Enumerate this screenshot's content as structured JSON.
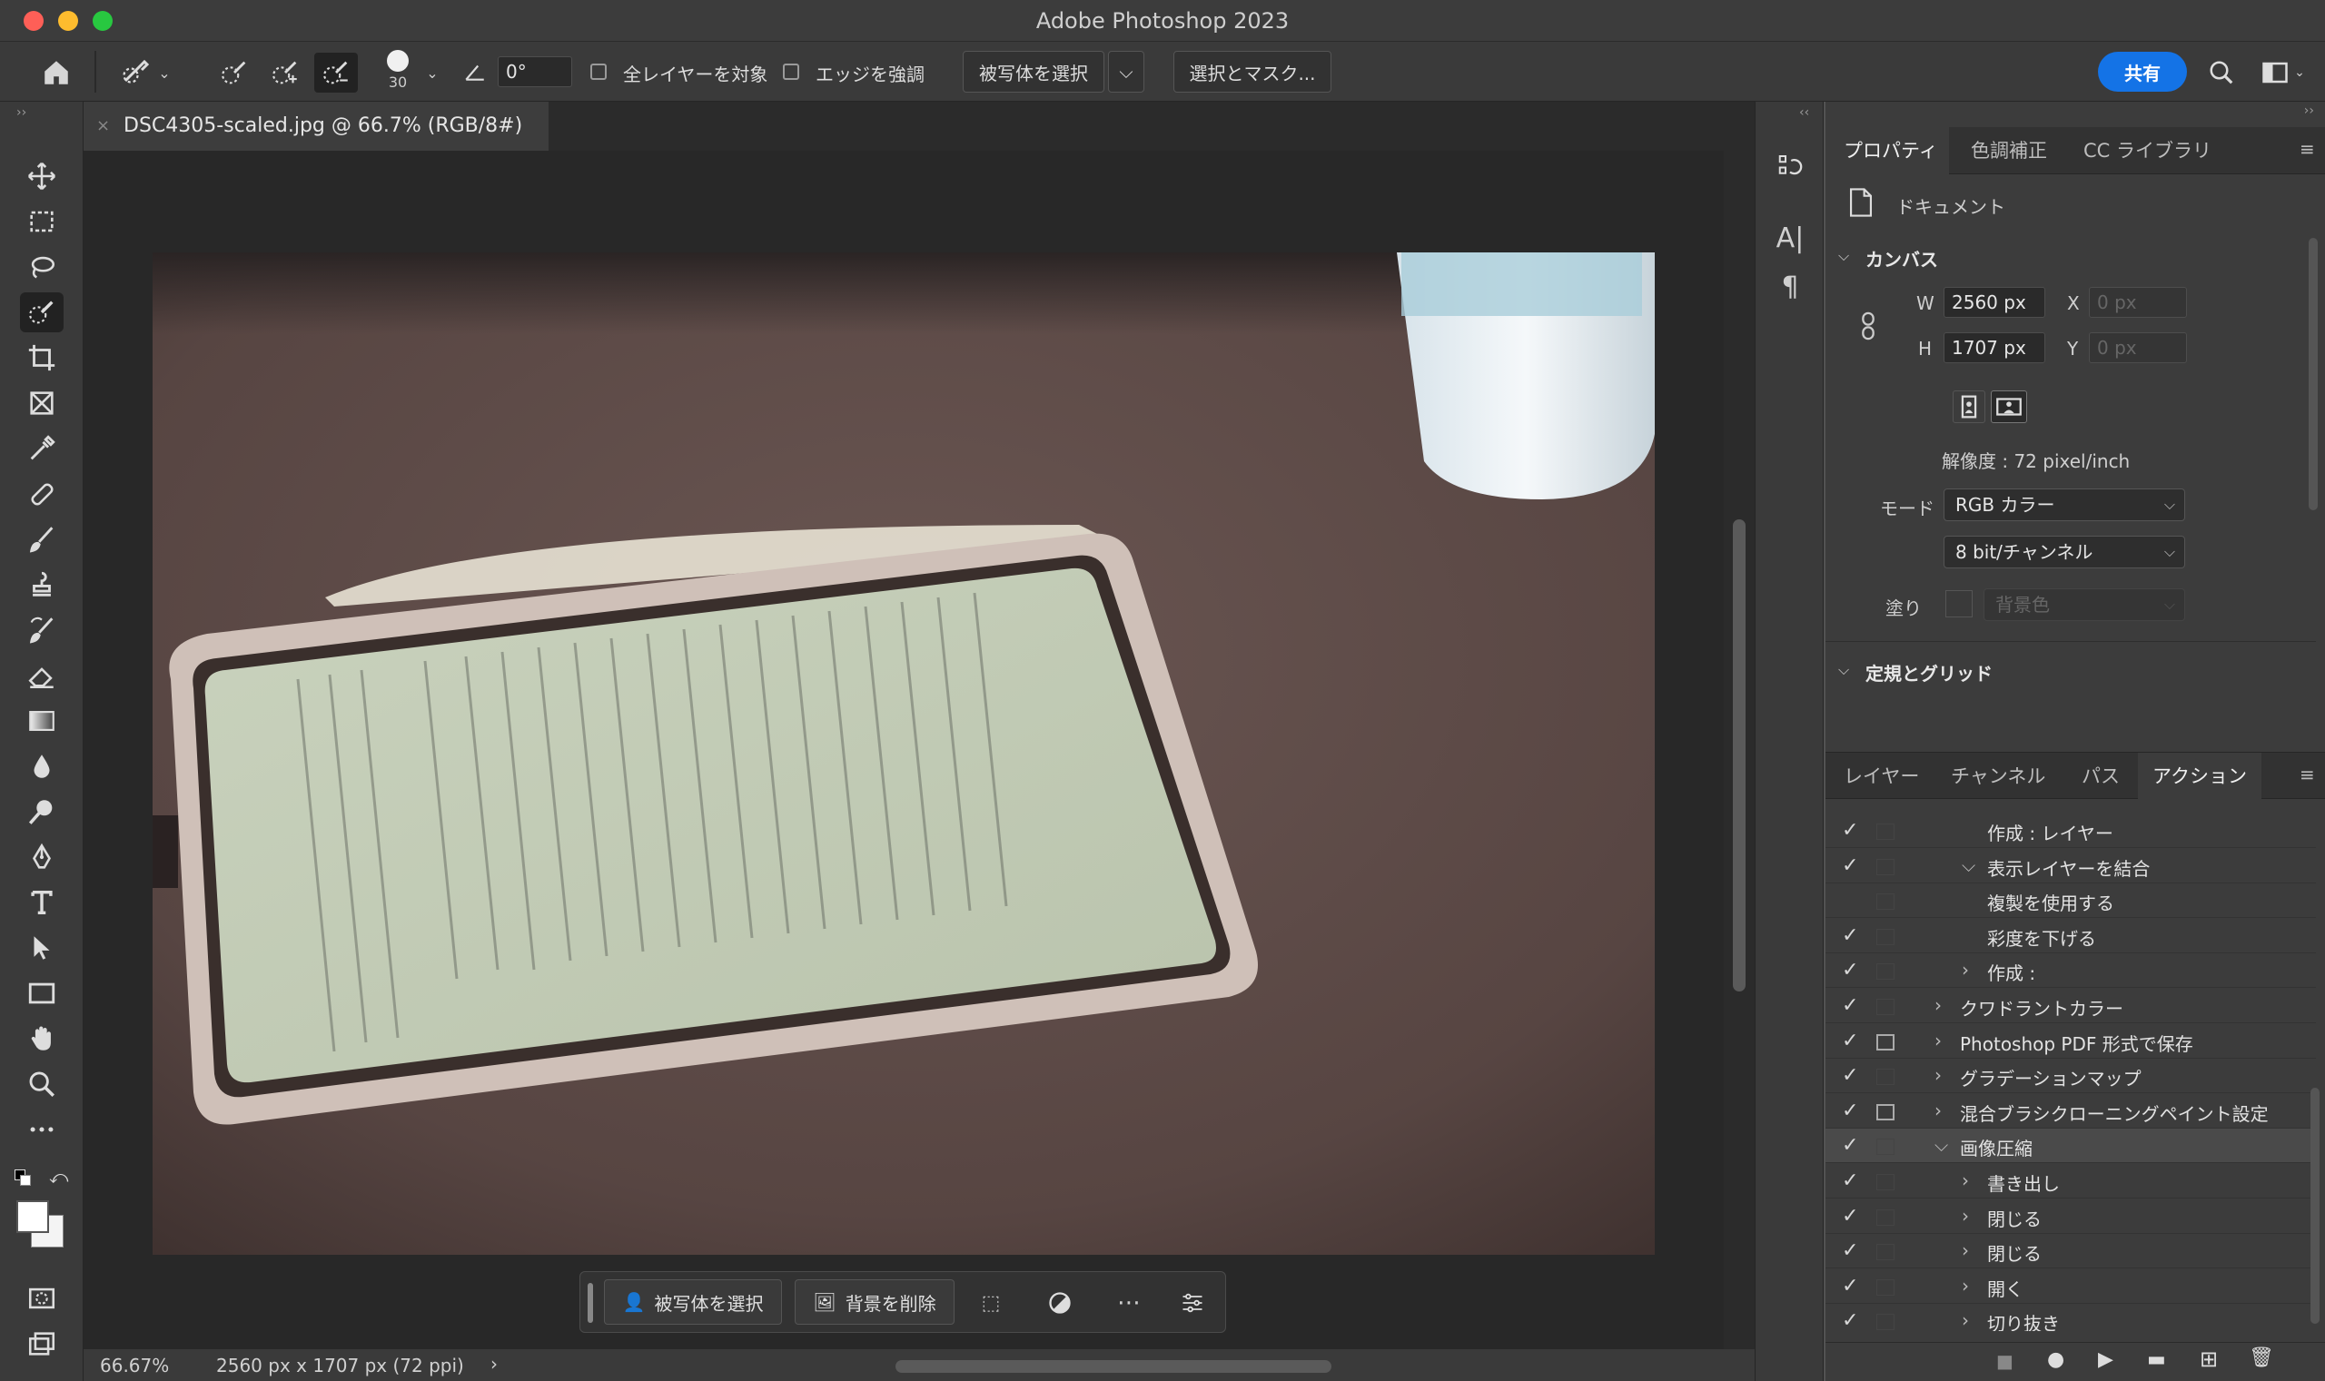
{
  "window": {
    "title": "Adobe Photoshop 2023",
    "traffic_colors": {
      "close": "#fe5f57",
      "minimize": "#febc2e",
      "zoom": "#28c840"
    }
  },
  "options_bar": {
    "brush_size": "30",
    "angle": "0°",
    "sample_all_layers": "全レイヤーを対象",
    "enhance_edge": "エッジを強調",
    "select_subject": "被写体を選択",
    "select_and_mask": "選択とマスク...",
    "share": "共有",
    "accent": "#1473e6"
  },
  "document": {
    "tab_label": "DSC4305-scaled.jpg @ 66.7% (RGB/8#)"
  },
  "status": {
    "zoom": "66.67%",
    "doc_info": "2560 px x 1707 px (72 ppi)"
  },
  "contextual_taskbar": {
    "select_subject": "被写体を選択",
    "remove_background": "背景を削除"
  },
  "properties": {
    "tabs": [
      "プロパティ",
      "色調補正",
      "CC ライブラリ"
    ],
    "doc_label": "ドキュメント",
    "canvas_section": "カンバス",
    "w_label": "W",
    "w_value": "2560 px",
    "h_label": "H",
    "h_value": "1707 px",
    "x_label": "X",
    "x_value": "0 px",
    "y_label": "Y",
    "y_value": "0 px",
    "resolution": "解像度 : 72 pixel/inch",
    "mode_label": "モード",
    "mode_value": "RGB カラー",
    "depth_value": "8 bit/チャンネル",
    "fill_label": "塗り",
    "fill_value": "背景色",
    "rulers_section": "定規とグリッド"
  },
  "layers_panel": {
    "tabs": [
      "レイヤー",
      "チャンネル",
      "パス",
      "アクション"
    ],
    "actions": [
      {
        "name": "作成 : レイヤー",
        "checked": true,
        "dialog": false,
        "indent": 2,
        "expand": ""
      },
      {
        "name": "表示レイヤーを結合",
        "checked": true,
        "dialog": false,
        "indent": 2,
        "expand": "v"
      },
      {
        "name": "複製を使用する",
        "checked": false,
        "dialog": false,
        "indent": 2,
        "expand": ""
      },
      {
        "name": "彩度を下げる",
        "checked": true,
        "dialog": false,
        "indent": 2,
        "expand": ""
      },
      {
        "name": "作成 :",
        "checked": true,
        "dialog": false,
        "indent": 2,
        "expand": ">"
      },
      {
        "name": "クワドラントカラー",
        "checked": true,
        "dialog": false,
        "indent": 1,
        "expand": ">"
      },
      {
        "name": "Photoshop PDF 形式で保存",
        "checked": true,
        "dialog": true,
        "indent": 1,
        "expand": ">"
      },
      {
        "name": "グラデーションマップ",
        "checked": true,
        "dialog": false,
        "indent": 1,
        "expand": ">"
      },
      {
        "name": "混合ブラシクローニングペイント設定",
        "checked": true,
        "dialog": true,
        "indent": 1,
        "expand": ">"
      },
      {
        "name": "画像圧縮",
        "checked": true,
        "dialog": false,
        "indent": 1,
        "expand": "v",
        "selected": true
      },
      {
        "name": "書き出し",
        "checked": true,
        "dialog": false,
        "indent": 2,
        "expand": ">"
      },
      {
        "name": "閉じる",
        "checked": true,
        "dialog": false,
        "indent": 2,
        "expand": ">"
      },
      {
        "name": "閉じる",
        "checked": true,
        "dialog": false,
        "indent": 2,
        "expand": ">"
      },
      {
        "name": "開く",
        "checked": true,
        "dialog": false,
        "indent": 2,
        "expand": ">"
      },
      {
        "name": "切り抜き",
        "checked": true,
        "dialog": false,
        "indent": 2,
        "expand": ">"
      }
    ]
  }
}
